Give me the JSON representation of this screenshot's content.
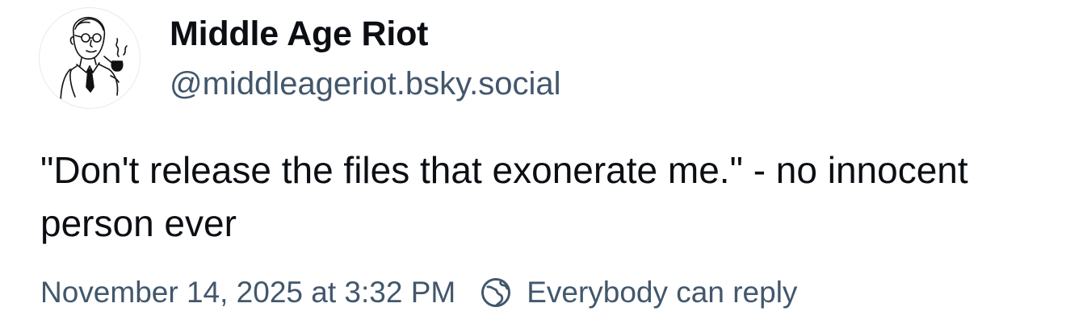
{
  "author": {
    "display_name": "Middle Age Riot",
    "handle": "@middleageriot.bsky.social",
    "avatar_icon": "man-with-pipe-illustration-icon"
  },
  "post": {
    "text": "\"Don't release the files that exonerate me.\" - no innocent person ever"
  },
  "meta": {
    "timestamp": "November 14, 2025 at 3:32 PM",
    "reply_setting": "Everybody can reply",
    "reply_icon": "globe-icon"
  },
  "colors": {
    "text_primary": "#0b0f14",
    "text_secondary": "#42576c",
    "background": "#ffffff"
  }
}
